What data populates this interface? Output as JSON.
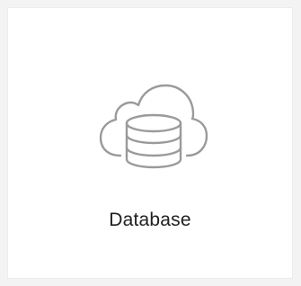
{
  "tile": {
    "label": "Database",
    "icon": "cloud-database-icon"
  }
}
